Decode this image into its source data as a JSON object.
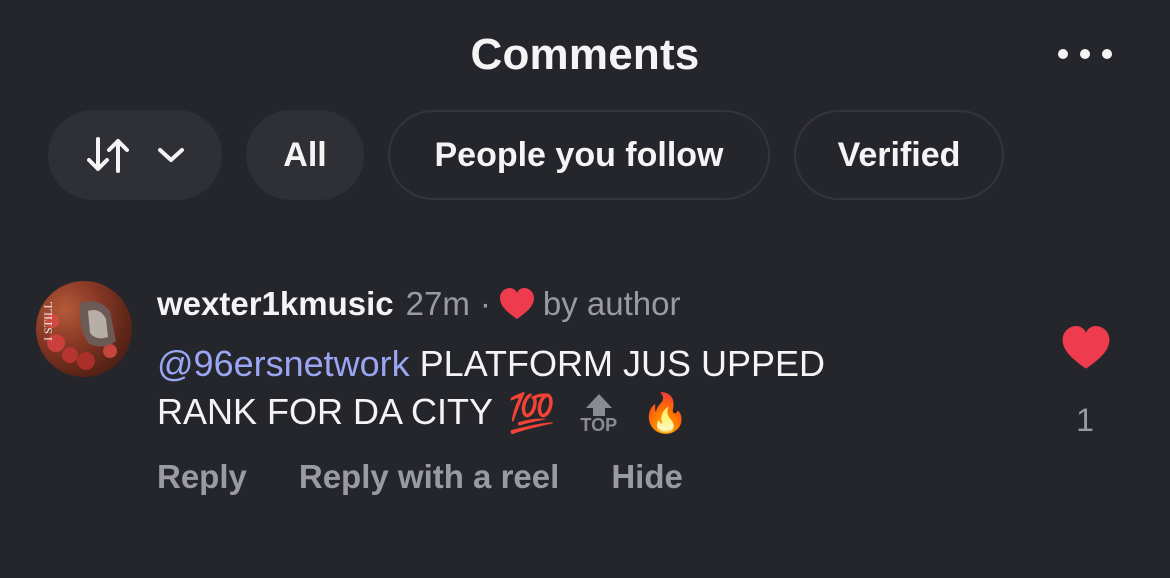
{
  "header": {
    "title": "Comments"
  },
  "filters": {
    "all": "All",
    "people_you_follow": "People you follow",
    "verified": "Verified"
  },
  "comment": {
    "username": "wexter1kmusic",
    "time": "27m",
    "separator": "·",
    "liked_by": "by author",
    "mention": "@96ersnetwork",
    "text_line1": " PLATFORM JUS UPPED",
    "text_line2": "RANK FOR DA CITY",
    "emoji_hundred": "💯",
    "emoji_fire": "🔥",
    "top_label": "TOP",
    "actions": {
      "reply": "Reply",
      "reply_reel": "Reply with a reel",
      "hide": "Hide"
    },
    "like_count": "1"
  },
  "colors": {
    "background": "#25262b",
    "mention": "#9aa5f4",
    "heart": "#ee3b4d",
    "muted": "#9a9ba1"
  },
  "icons": [
    "sort-icon",
    "chevron-down-icon",
    "more-icon",
    "heart-icon",
    "top-arrow-icon"
  ]
}
